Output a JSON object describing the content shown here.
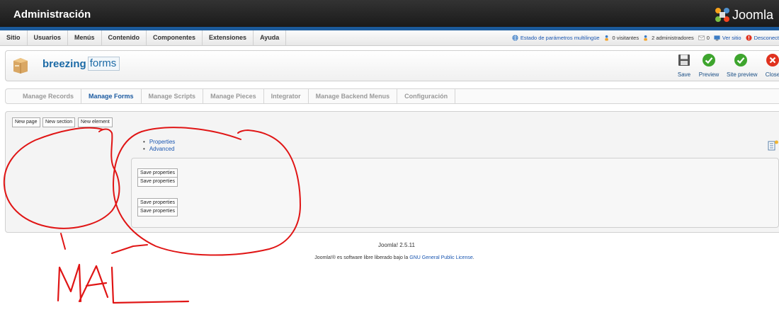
{
  "header": {
    "title": "Administración",
    "logo_text": "Joomla"
  },
  "menubar": {
    "items": [
      "Sitio",
      "Usuarios",
      "Menús",
      "Contenido",
      "Componentes",
      "Extensiones",
      "Ayuda"
    ],
    "status": {
      "multilingual": "Estado de parámetros multilingüe",
      "visitors": "0 visitantes",
      "admins": "2 administradores",
      "messages": "0",
      "view_site": "Ver sitio",
      "logout": "Desconect"
    }
  },
  "component": {
    "brand_bold": "breezing",
    "brand_boxed": "forms"
  },
  "toolbar": {
    "save": "Save",
    "preview": "Preview",
    "site_preview": "Site preview",
    "close": "Close"
  },
  "submenu": {
    "items": [
      "Manage Records",
      "Manage Forms",
      "Manage Scripts",
      "Manage Pieces",
      "Integrator",
      "Manage Backend Menus",
      "Configuración"
    ],
    "active_index": 1
  },
  "editor": {
    "new_page": "New page",
    "new_section": "New section",
    "new_element": "New element",
    "links": [
      "Properties",
      "Advanced"
    ],
    "save_properties": [
      "Save properties",
      "Save properties",
      "Save properties",
      "Save properties"
    ]
  },
  "footer": {
    "version": "Joomla! 2.5.11",
    "license_prefix": "Joomla!® es software libre liberado bajo la ",
    "license_link": "GNU General Public License",
    "license_suffix": "."
  },
  "annotation": {
    "text": "MAL"
  },
  "colors": {
    "header_bg": "#1a1a1a",
    "header_stripe": "#1b5a9b",
    "link": "#1b57b1",
    "annotation": "#e01515"
  }
}
